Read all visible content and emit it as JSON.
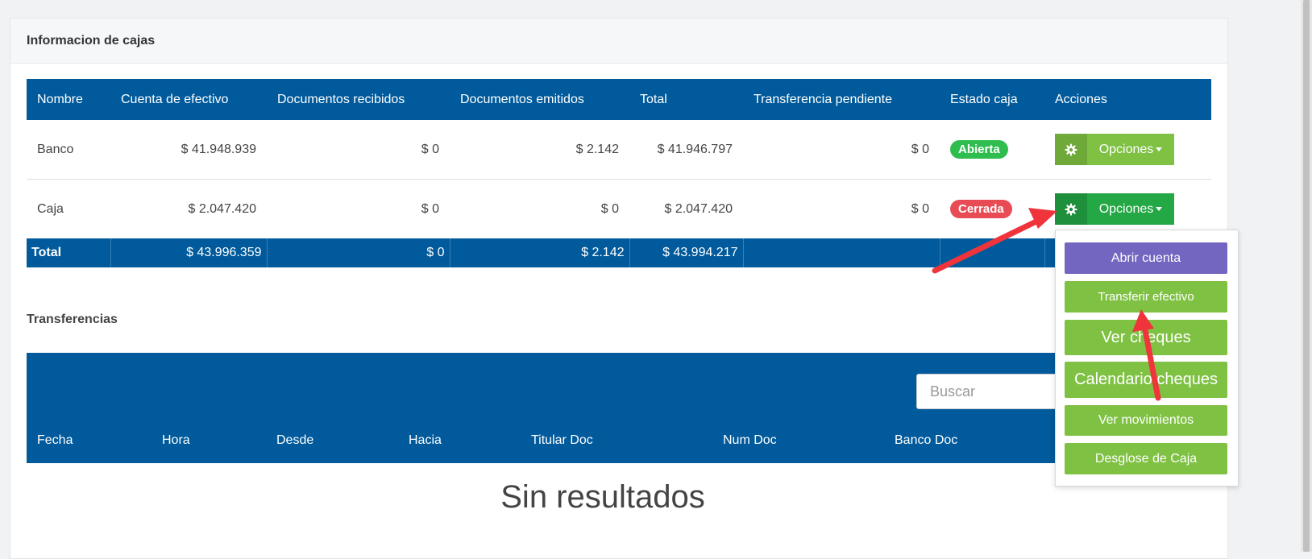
{
  "panel": {
    "title": "Informacion de cajas"
  },
  "cajas": {
    "headers": [
      "Nombre",
      "Cuenta de efectivo",
      "Documentos recibidos",
      "Documentos emitidos",
      "Total",
      "Transferencia pendiente",
      "Estado caja",
      "Acciones"
    ],
    "rows": [
      {
        "nombre": "Banco",
        "cuenta_efectivo": "$ 41.948.939",
        "doc_recibidos": "$ 0",
        "doc_emitidos": "$ 2.142",
        "total": "$ 41.946.797",
        "transf_pendiente": "$ 0",
        "estado": "Abierta",
        "accion": "Opciones"
      },
      {
        "nombre": "Caja",
        "cuenta_efectivo": "$ 2.047.420",
        "doc_recibidos": "$ 0",
        "doc_emitidos": "$ 0",
        "total": "$ 2.047.420",
        "transf_pendiente": "$ 0",
        "estado": "Cerrada",
        "accion": "Opciones"
      }
    ],
    "footer": {
      "label": "Total",
      "cuenta_efectivo": "$ 43.996.359",
      "doc_recibidos": "$ 0",
      "doc_emitidos": "$ 2.142",
      "total": "$ 43.994.217"
    }
  },
  "dropdown": {
    "items": [
      "Abrir cuenta",
      "Transferir efectivo",
      "Ver cheques",
      "Calendario cheques",
      "Ver movimientos",
      "Desglose de Caja"
    ]
  },
  "transferencias": {
    "title": "Transferencias",
    "search_placeholder": "Buscar",
    "headers": [
      "Fecha",
      "Hora",
      "Desde",
      "Hacia",
      "Titular Doc",
      "Num Doc",
      "Banco Doc"
    ],
    "empty": "Sin resultados"
  },
  "colors": {
    "header_blue": "#005a9c",
    "open_badge": "#2ebd4e",
    "closed_badge": "#e94b55",
    "option_green": "#7fc143",
    "purple": "#7366c0",
    "annotation_red": "#f0343c"
  }
}
